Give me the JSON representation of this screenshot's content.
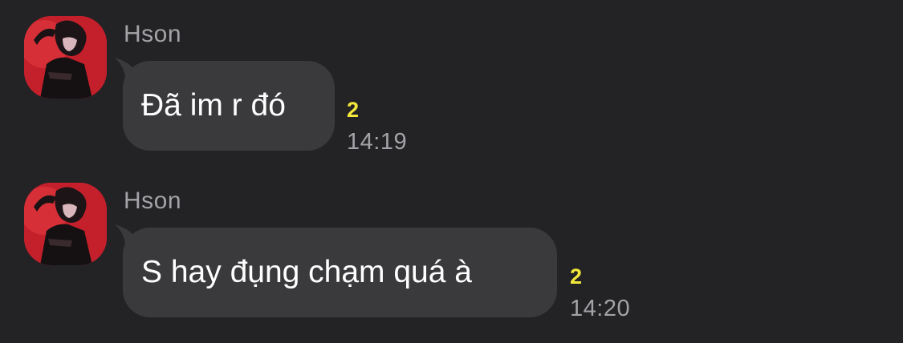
{
  "messages": [
    {
      "sender": "Hson",
      "text": "Đã im r đó",
      "read_count": "2",
      "time": "14:19",
      "avatar": "profile-photo"
    },
    {
      "sender": "Hson",
      "text": "S hay đụng chạm quá à",
      "read_count": "2",
      "time": "14:20",
      "avatar": "profile-photo"
    }
  ],
  "colors": {
    "background": "#232325",
    "bubble": "#3a3a3c",
    "read_count": "#f3e83a",
    "meta_text": "#a3a3a8",
    "avatar_bg": "#c4202c"
  }
}
